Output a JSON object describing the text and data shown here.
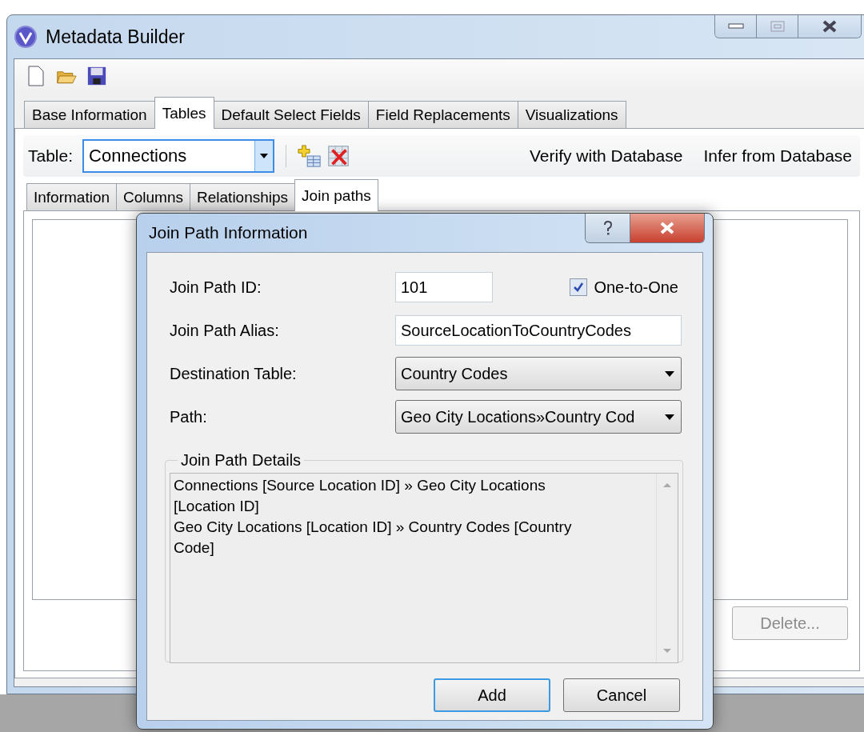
{
  "window": {
    "title": "Metadata Builder"
  },
  "tabs": [
    {
      "label": "Base Information",
      "selected": false
    },
    {
      "label": "Tables",
      "selected": true
    },
    {
      "label": "Default Select Fields",
      "selected": false
    },
    {
      "label": "Field Replacements",
      "selected": false
    },
    {
      "label": "Visualizations",
      "selected": false
    }
  ],
  "table_selector": {
    "label": "Table:",
    "value": "Connections"
  },
  "links": [
    "Verify with Database",
    "Infer from Database"
  ],
  "subtabs": [
    {
      "label": "Information",
      "selected": false
    },
    {
      "label": "Columns",
      "selected": false
    },
    {
      "label": "Relationships",
      "selected": false
    },
    {
      "label": "Join paths",
      "selected": true
    }
  ],
  "delete_button": {
    "label": "Delete...",
    "disabled": true
  },
  "dialog": {
    "title": "Join Path Information",
    "fields": [
      {
        "kind": "text",
        "label": "Join Path ID:",
        "value": "101"
      },
      {
        "kind": "text",
        "label": "Join Path Alias:",
        "value": "SourceLocationToCountryCodes"
      },
      {
        "kind": "dropdown",
        "label": "Destination Table:",
        "value": "Country Codes"
      },
      {
        "kind": "dropdown",
        "label": "Path:",
        "value": "Geo City Locations»Country Cod"
      }
    ],
    "option": {
      "label": "One-to-One",
      "checked": true
    },
    "details": {
      "legend": "Join Path Details",
      "lines": [
        "Connections [Source Location ID] » Geo City Locations [Location ID]",
        "Geo City Locations [Location ID] » Country Codes [Country Code]"
      ]
    },
    "buttons": [
      {
        "label": "Add",
        "default": true
      },
      {
        "label": "Cancel",
        "default": false
      }
    ]
  }
}
